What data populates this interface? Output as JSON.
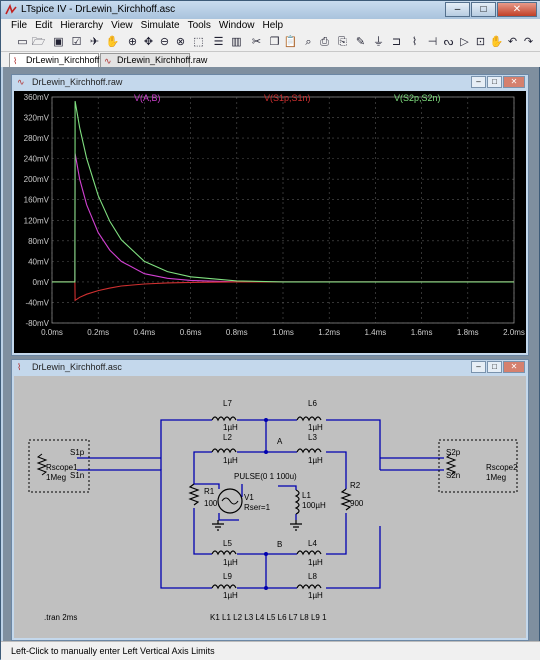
{
  "app": {
    "title": "LTspice IV - DrLewin_Kirchhoff.asc"
  },
  "window_buttons": {
    "minimize": "–",
    "maximize": "□",
    "close": "✕"
  },
  "menus": [
    "File",
    "Edit",
    "Hierarchy",
    "View",
    "Simulate",
    "Tools",
    "Window",
    "Help"
  ],
  "toolbar_icons": [
    "new-schematic-icon",
    "open-icon",
    "save-icon",
    "control-panel-icon",
    "run-icon",
    "halt-icon",
    "zoom-in-icon",
    "zoom-pan-icon",
    "zoom-out-icon",
    "zoom-fit-icon",
    "autorange-icon",
    "tile-horizontal-icon",
    "tile-vertical-icon",
    "cut-icon",
    "copy-icon",
    "paste-icon",
    "find-icon",
    "print-icon",
    "print-preview-icon",
    "wire-icon",
    "ground-icon",
    "label-icon",
    "resistor-icon",
    "capacitor-icon",
    "inductor-icon",
    "diode-icon",
    "component-icon",
    "move-icon",
    "drag-icon",
    "undo-icon",
    "redo-icon"
  ],
  "tabs": [
    {
      "label": "DrLewin_Kirchhoff.asc",
      "active": true
    },
    {
      "label": "DrLewin_Kirchhoff.raw",
      "active": false
    }
  ],
  "waveform": {
    "title": "DrLewin_Kirchhoff.raw"
  },
  "schematic": {
    "title": "DrLewin_Kirchhoff.asc"
  },
  "chart_data": {
    "type": "line",
    "xlabel": "",
    "ylabel": "",
    "xlim": [
      0,
      2.0
    ],
    "ylim": [
      -80,
      360
    ],
    "x_ticks": [
      "0.0ms",
      "0.2ms",
      "0.4ms",
      "0.6ms",
      "0.8ms",
      "1.0ms",
      "1.2ms",
      "1.4ms",
      "1.6ms",
      "1.8ms",
      "2.0ms"
    ],
    "y_ticks": [
      "360mV",
      "320mV",
      "280mV",
      "240mV",
      "200mV",
      "160mV",
      "120mV",
      "80mV",
      "40mV",
      "0mV",
      "-40mV",
      "-80mV"
    ],
    "series": [
      {
        "name": "V(A,B)",
        "color": "#d040d0",
        "x": [
          0,
          0.099,
          0.1,
          0.12,
          0.15,
          0.2,
          0.25,
          0.3,
          0.4,
          0.5,
          0.6,
          0.8,
          1.0,
          2.0
        ],
        "y": [
          0,
          0,
          250,
          200,
          150,
          96,
          62,
          40,
          16,
          7,
          3,
          0,
          0,
          0
        ]
      },
      {
        "name": "V(S1p,S1n)",
        "color": "#d03030",
        "x": [
          0,
          0.099,
          0.1,
          0.12,
          0.15,
          0.2,
          0.25,
          0.3,
          0.4,
          0.5,
          0.6,
          0.8,
          1.0,
          2.0
        ],
        "y": [
          0,
          0,
          -36,
          -30,
          -24,
          -17,
          -12,
          -8,
          -4,
          -2,
          -1,
          0,
          0,
          0
        ]
      },
      {
        "name": "V(S2p,S2n)",
        "color": "#80e080",
        "x": [
          0,
          0.099,
          0.1,
          0.12,
          0.15,
          0.2,
          0.25,
          0.3,
          0.4,
          0.5,
          0.6,
          0.8,
          1.0,
          2.0
        ],
        "y": [
          0,
          0,
          352,
          300,
          240,
          168,
          118,
          82,
          40,
          20,
          10,
          2,
          0,
          0
        ]
      }
    ]
  },
  "circuit": {
    "inductors": {
      "L7": {
        "name": "L7",
        "value": "1µH"
      },
      "L6": {
        "name": "L6",
        "value": "1µH"
      },
      "L2": {
        "name": "L2",
        "value": "1µH"
      },
      "L3": {
        "name": "L3",
        "value": "1µH"
      },
      "L1": {
        "name": "L1",
        "value": "100µH"
      },
      "L5": {
        "name": "L5",
        "value": "1µH"
      },
      "L4": {
        "name": "L4",
        "value": "1µH"
      },
      "L9": {
        "name": "L9",
        "value": "1µH"
      },
      "L8": {
        "name": "L8",
        "value": "1µH"
      }
    },
    "resistors": {
      "R1": {
        "name": "R1",
        "value": "100"
      },
      "R2": {
        "name": "R2",
        "value": "900"
      }
    },
    "source": {
      "name": "V1",
      "value": "PULSE(0 1 100u)",
      "rser": "Rser=1"
    },
    "scopes": {
      "left": {
        "name": "Rscope1",
        "value": "1Meg",
        "pos": "S1p",
        "neg": "S1n"
      },
      "right": {
        "name": "Rscope2",
        "value": "1Meg",
        "pos": "S2p",
        "neg": "S2n"
      }
    },
    "node_a": "A",
    "node_b": "B",
    "directive": ".tran 2ms",
    "coupling": "K1 L1 L2 L3 L4 L5 L6 L7 L8 L9 1"
  },
  "status": {
    "text": "Left-Click to manually enter Left Vertical Axis Limits"
  }
}
